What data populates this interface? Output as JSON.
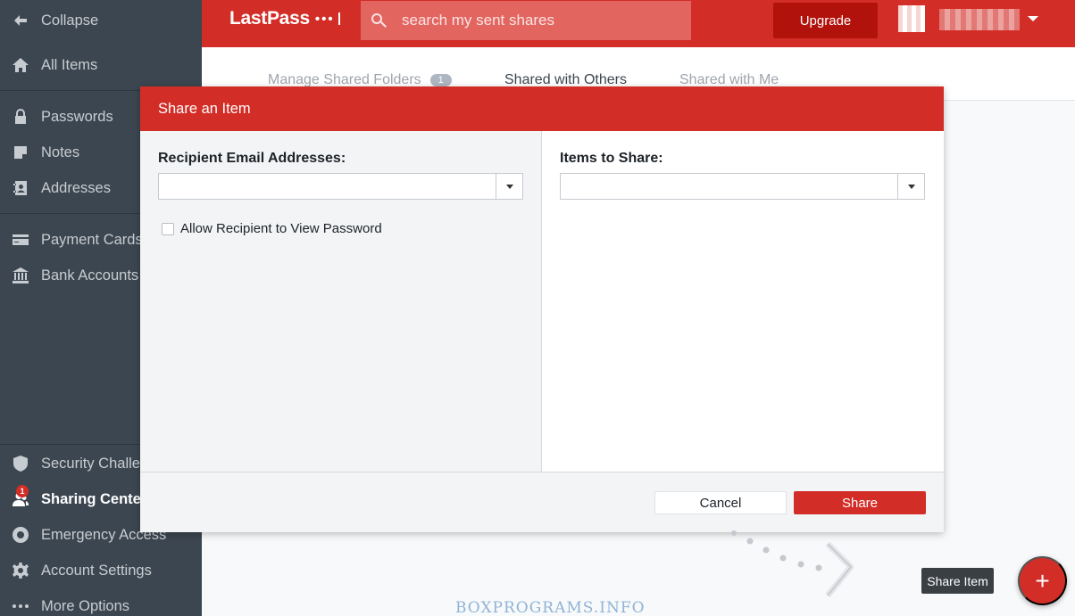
{
  "sidebar": {
    "items": [
      {
        "label": "Collapse",
        "icon": "arrow-left-icon"
      },
      {
        "label": "All Items",
        "icon": "home-icon"
      },
      {
        "label": "Passwords",
        "icon": "lock-icon"
      },
      {
        "label": "Notes",
        "icon": "note-icon"
      },
      {
        "label": "Addresses",
        "icon": "address-book-icon"
      },
      {
        "label": "Payment Cards",
        "icon": "credit-card-icon"
      },
      {
        "label": "Bank Accounts",
        "icon": "bank-icon"
      },
      {
        "label": "Security Challenge",
        "icon": "shield-icon"
      },
      {
        "label": "Sharing Center",
        "icon": "sharing-icon",
        "badge": "1",
        "active": true
      },
      {
        "label": "Emergency Access",
        "icon": "lifebuoy-icon"
      },
      {
        "label": "Account Settings",
        "icon": "gear-icon"
      },
      {
        "label": "More Options",
        "icon": "more-icon"
      }
    ]
  },
  "header": {
    "logo_text": "LastPass",
    "logo_dots": "•••",
    "search_placeholder": "search my sent shares",
    "upgrade_label": "Upgrade"
  },
  "tabs": [
    {
      "label": "Manage Shared Folders",
      "badge": "1"
    },
    {
      "label": "Shared with Others",
      "active": true
    },
    {
      "label": "Shared with Me"
    }
  ],
  "modal": {
    "title": "Share an Item",
    "recipient_label": "Recipient Email Addresses:",
    "recipient_value": "",
    "allow_view_password_label": "Allow Recipient to View Password",
    "items_label": "Items to Share:",
    "items_value": "",
    "cancel_label": "Cancel",
    "share_label": "Share"
  },
  "fab": {
    "tooltip": "Share Item",
    "icon_glyph": "+"
  },
  "watermark": "BOXPROGRAMS.INFO",
  "colors": {
    "brand_red": "#d32d27",
    "sidebar_bg": "#3c4650",
    "upgrade_bg": "#b2120c"
  }
}
